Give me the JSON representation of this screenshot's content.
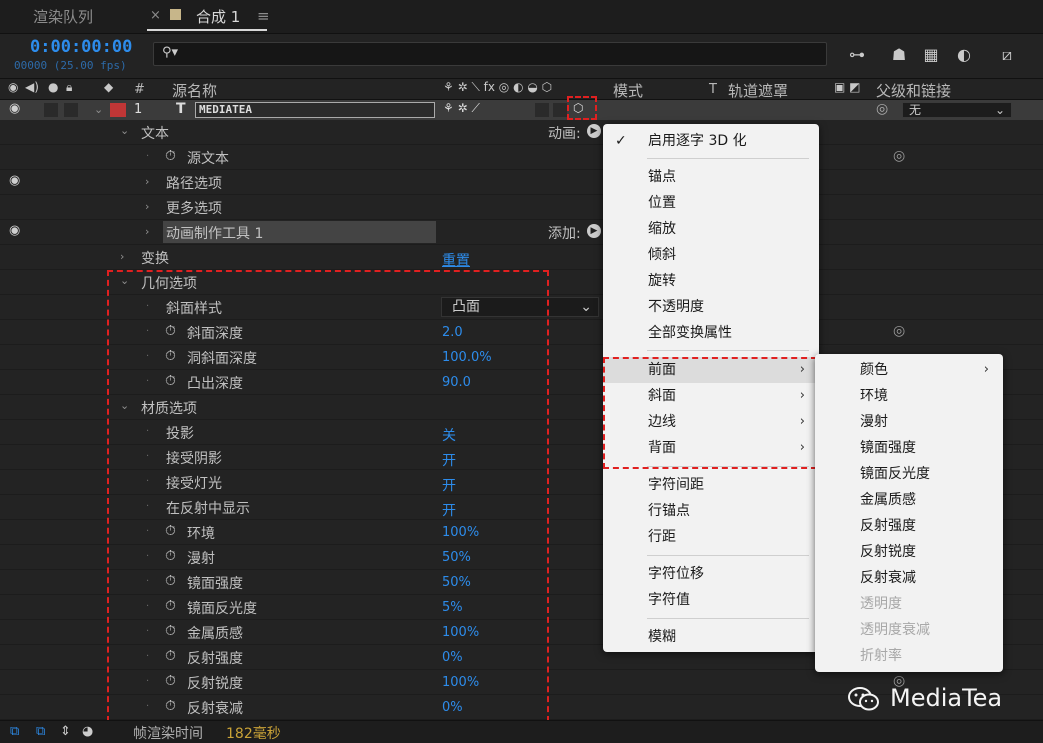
{
  "tabs": [
    {
      "label": "渲染队列",
      "active": false
    },
    {
      "label": "合成 1",
      "active": true
    }
  ],
  "timecode": "0:00:00:00",
  "fps_readout": "00000 (25.00 fps)",
  "columns": {
    "hash": "#",
    "source_name": "源名称",
    "mode": "模式",
    "t": "T",
    "track_matte": "轨道遮罩",
    "parent": "父级和链接"
  },
  "layer": {
    "number": "1",
    "type_glyph": "T",
    "name": "MEDIATEA",
    "parent_value": "无",
    "color": "#c03636"
  },
  "properties": {
    "text": "文本",
    "source_text": "源文本",
    "path_options": "路径选项",
    "more_options": "更多选项",
    "animator": "动画制作工具 1",
    "animate_label": "动画:",
    "add_label": "添加:",
    "transform": "变换",
    "reset": "重置",
    "geometry": "几何选项",
    "bevel_style": "斜面样式",
    "bevel_style_value": "凸面",
    "bevel_depth": "斜面深度",
    "bevel_depth_value": "2.0",
    "hole_bevel_depth": "洞斜面深度",
    "hole_bevel_depth_value": "100.0%",
    "extrusion_depth": "凸出深度",
    "extrusion_depth_value": "90.0",
    "material": "材质选项",
    "casts_shadows": "投影",
    "casts_shadows_value": "关",
    "accepts_shadows": "接受阴影",
    "accepts_shadows_value": "开",
    "accepts_lights": "接受灯光",
    "accepts_lights_value": "开",
    "appears_in_reflections": "在反射中显示",
    "appears_in_reflections_value": "开",
    "ambient": "环境",
    "ambient_value": "100%",
    "diffuse": "漫射",
    "diffuse_value": "50%",
    "specular_intensity": "镜面强度",
    "specular_intensity_value": "50%",
    "specular_shininess": "镜面反光度",
    "specular_shininess_value": "5%",
    "metal": "金属质感",
    "metal_value": "100%",
    "reflection_intensity": "反射强度",
    "reflection_intensity_value": "0%",
    "reflection_sharpness": "反射锐度",
    "reflection_sharpness_value": "100%",
    "reflection_rolloff": "反射衰减",
    "reflection_rolloff_value": "0%"
  },
  "animate_menu": {
    "checked_item": "启用逐字 3D 化",
    "group1": [
      "锚点",
      "位置",
      "缩放",
      "倾斜",
      "旋转",
      "不透明度",
      "全部变换属性"
    ],
    "group2": [
      "前面",
      "斜面",
      "边线",
      "背面"
    ],
    "group3": [
      "字符间距",
      "行锚点",
      "行距"
    ],
    "group4": [
      "字符位移",
      "字符值"
    ],
    "group5": [
      "模糊"
    ]
  },
  "submenu": {
    "items": [
      "颜色",
      "环境",
      "漫射",
      "镜面强度",
      "镜面反光度",
      "金属质感",
      "反射强度",
      "反射锐度",
      "反射衰减"
    ],
    "disabled_items": [
      "透明度",
      "透明度衰减",
      "折射率"
    ]
  },
  "status": {
    "render_label": "帧渲染时间",
    "render_time": "182毫秒"
  },
  "watermark": "MediaTea"
}
